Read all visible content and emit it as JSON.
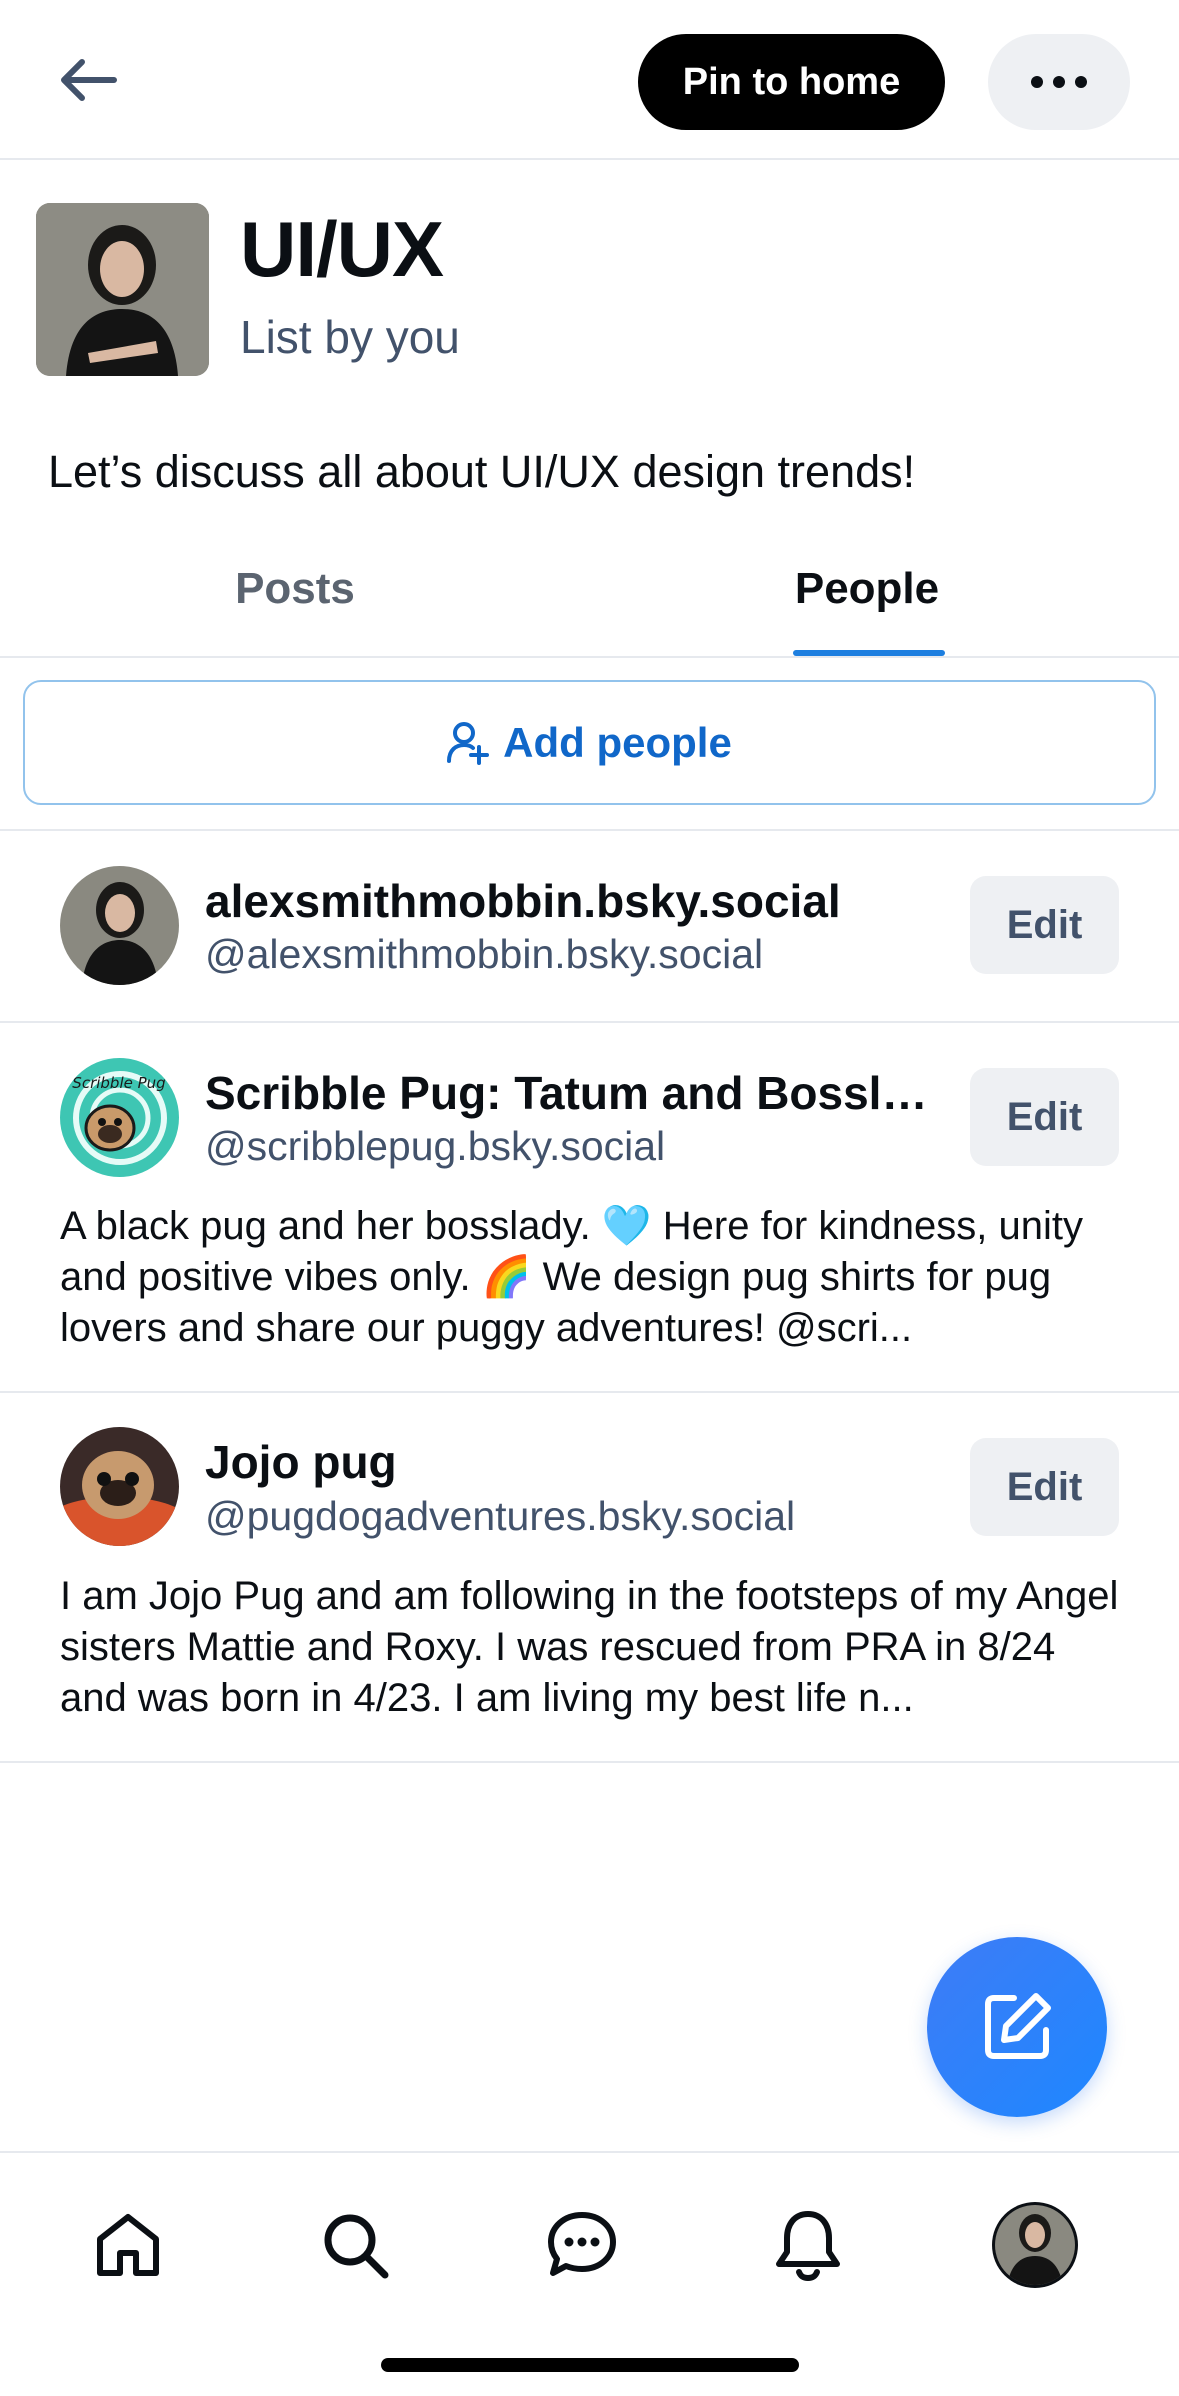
{
  "header": {
    "pin_label": "Pin to home"
  },
  "list": {
    "title": "UI/UX",
    "subtitle": "List by you",
    "description": "Let’s discuss all about UI/UX design trends!"
  },
  "tabs": [
    {
      "label": "Posts",
      "active": false
    },
    {
      "label": "People",
      "active": true
    }
  ],
  "add_people_label": "Add people",
  "people": [
    {
      "name": "alexsmithmobbin.bsky.social",
      "handle": "@alexsmithmobbin.bsky.social",
      "edit_label": "Edit",
      "bio": ""
    },
    {
      "name": "Scribble Pug: Tatum and Bossla...",
      "handle": "@scribblepug.bsky.social",
      "edit_label": "Edit",
      "avatar_text": "Scribble Pug",
      "bio": "A black pug and her bosslady. 🩵 Here for kindness, unity and positive vibes only. 🌈 We design pug shirts for pug lovers and share our puggy adventures! @scri..."
    },
    {
      "name": "Jojo pug",
      "handle": "@pugdogadventures.bsky.social",
      "edit_label": "Edit",
      "bio": "I am Jojo Pug and am following in the footsteps of my Angel sisters Mattie and Roxy.  I was rescued from PRA in 8/24 and was born in 4/23.  I am living my best life n..."
    }
  ],
  "nav": [
    "home-icon",
    "search-icon",
    "chat-icon",
    "bell-icon",
    "profile-avatar"
  ],
  "colors": {
    "accent": "#1d7fe0",
    "fab": "#2a82fb",
    "muted_text": "#42526b"
  }
}
